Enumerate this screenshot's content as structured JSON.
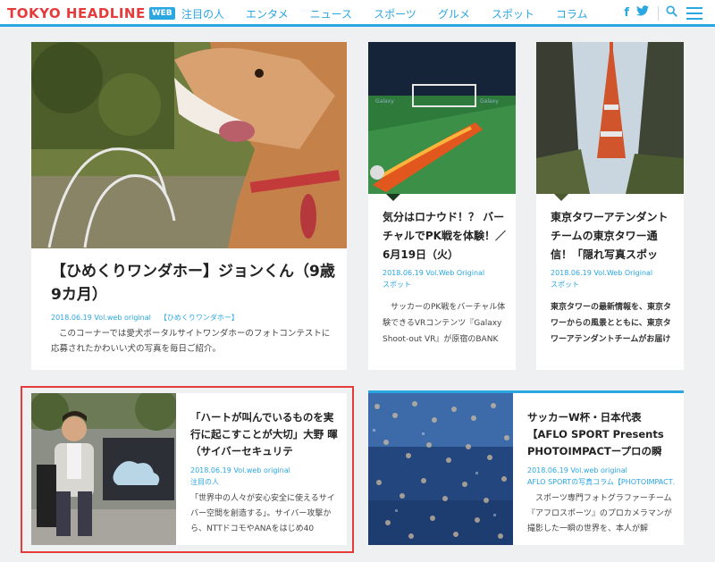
{
  "header": {
    "logo": "TOKYO HEADLINE",
    "logo_badge": "WEB",
    "nav": [
      "注目の人",
      "エンタメ",
      "ニュース",
      "スポーツ",
      "グルメ",
      "スポット",
      "コラム"
    ],
    "icons": [
      "facebook-icon",
      "twitter-icon",
      "search-icon",
      "menu-icon"
    ]
  },
  "colors": {
    "accent": "#2aa6e1",
    "logo": "#e53b3b",
    "bg": "#eef0f2"
  },
  "cards": [
    {
      "title": "【ひめくりワンダホー】ジョンくん（9歳9カ月）",
      "date": "2018.06.19 Vol.web original",
      "tag": "【ひめくりワンダホー】",
      "excerpt": "このコーナーでは愛犬ポータルサイトワンダホーのフォトコンテストに応募されたかわいい犬の写真を毎日ご紹介。"
    },
    {
      "title": "気分はロナウド！？ バーチャルでPK戦を体験！／6月19日（火）",
      "date": "2018.06.19 Vol.Web Original",
      "tag": "スポット",
      "excerpt": "サッカーのPK戦をバーチャル体験できるVRコンテンツ『Galaxy Shoot-out VR』が原宿のBANK GALLERYにて開催中。Gala"
    },
    {
      "title": "東京タワーアテンダントチームの東京タワー通信！「隠れ写真スポッ",
      "date": "2018.06.19 Vol.Web Original",
      "tag": "スポット",
      "excerpt": "東京タワーの最新情報を、東京タワーからの風景とともに、東京タワーアテンダントチームがお届けします！ 皆さん、こんに"
    },
    {
      "title": "「ハートが叫んでいるものを実行に起こすことが大切」大野 暉（サイバーセキュリテ",
      "date": "2018.06.19 Vol.web original",
      "tag": "注目の人",
      "excerpt": "「世界中の人々が安心安全に使えるサイバー空間を創造する」。サイバー攻撃から、NTTドコモやANAをはじめ40"
    },
    {
      "title": "サッカーW杯・日本代表【AFLO SPORT Presents PHOTOIMPACTープロの瞬",
      "date": "2018.06.19 Vol.web original",
      "tag": "AFLO SPORTの写真コラム【PHOTOIMPACT…",
      "excerpt": "スポーツ専門フォトグラファーチーム『アフロスポーツ』のプロカメラマンが撮影した一瞬の世界を、本人が解"
    }
  ]
}
